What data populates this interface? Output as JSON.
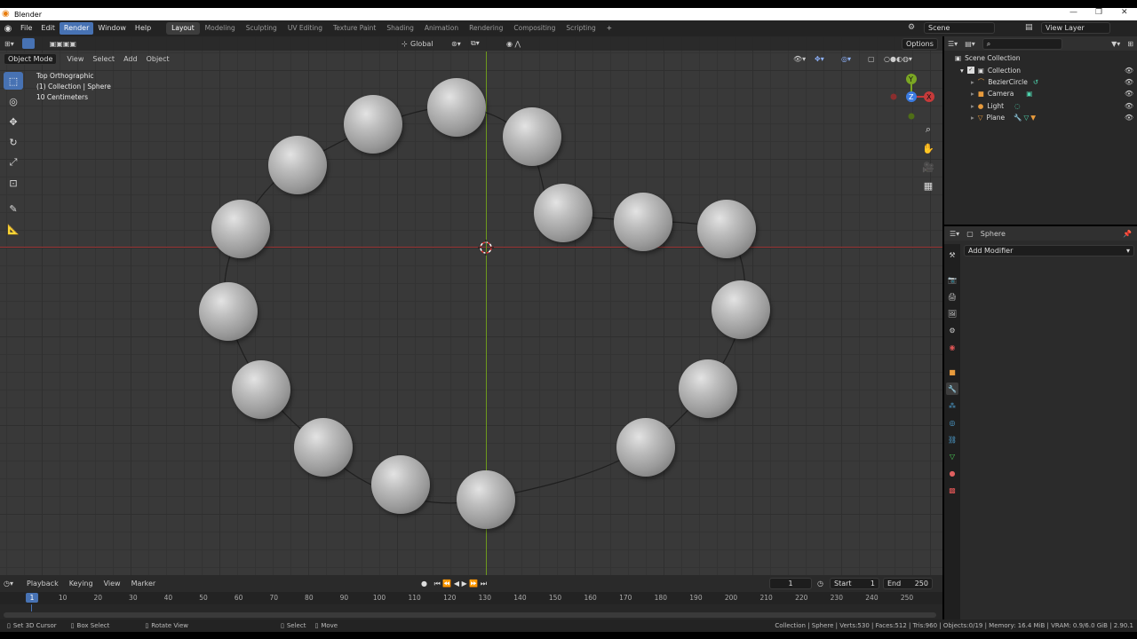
{
  "window": {
    "title": "Blender",
    "minimize": "—",
    "maximize": "❐",
    "close": "✕"
  },
  "menu": {
    "items": [
      "File",
      "Edit",
      "Render",
      "Window",
      "Help"
    ],
    "workspaces": [
      "Layout",
      "Modeling",
      "Sculpting",
      "UV Editing",
      "Texture Paint",
      "Shading",
      "Animation",
      "Rendering",
      "Compositing",
      "Scripting"
    ],
    "add_workspace": "+",
    "scene": "Scene",
    "view_layer": "View Layer"
  },
  "viewport": {
    "header": {
      "mode": "Object Mode",
      "menus": [
        "View",
        "Select",
        "Add",
        "Object"
      ],
      "transform_orientation": "Global",
      "options": "Options"
    },
    "overlay": {
      "view_name": "Top Orthographic",
      "collection": "(1) Collection | Sphere",
      "scale": "10 Centimeters"
    },
    "gizmo": {
      "y": "Y",
      "x": "X",
      "z": "Z"
    },
    "tools": [
      "select-box-icon",
      "cursor-icon",
      "move-icon",
      "rotate-icon",
      "scale-icon",
      "transform-icon",
      "annotate-icon",
      "measure-icon"
    ],
    "nav": [
      "zoom-icon",
      "hand-icon",
      "camera-icon",
      "grid-icon"
    ]
  },
  "outliner": {
    "root": "Scene Collection",
    "collection": "Collection",
    "items": [
      {
        "name": "BezierCircle",
        "icon": "curve-icon",
        "color": "#e89b3d"
      },
      {
        "name": "Camera",
        "icon": "camera-icon",
        "color": "#e89b3d"
      },
      {
        "name": "Light",
        "icon": "light-icon",
        "color": "#e89b3d"
      },
      {
        "name": "Plane",
        "icon": "mesh-icon",
        "color": "#e89b3d"
      }
    ]
  },
  "properties": {
    "object_name": "Sphere",
    "add_modifier": "Add Modifier",
    "tabs": [
      "tool",
      "render",
      "output",
      "view-layer",
      "scene",
      "world",
      "object",
      "modifier",
      "particles",
      "physics",
      "constraints",
      "data",
      "material",
      "texture"
    ]
  },
  "timeline": {
    "menus": [
      "Playback",
      "Keying",
      "View",
      "Marker"
    ],
    "current_frame": "1",
    "start_label": "Start",
    "start": "1",
    "end_label": "End",
    "end": "250",
    "ticks": [
      "10",
      "20",
      "30",
      "40",
      "50",
      "60",
      "70",
      "80",
      "90",
      "100",
      "110",
      "120",
      "130",
      "140",
      "150",
      "160",
      "170",
      "180",
      "190",
      "200",
      "210",
      "220",
      "230",
      "240",
      "250"
    ],
    "playhead": "1"
  },
  "status": {
    "left": [
      {
        "icon": "mouse-left-icon",
        "label": "Set 3D Cursor"
      },
      {
        "icon": "mouse-drag-icon",
        "label": "Box Select"
      },
      {
        "icon": "mouse-middle-icon",
        "label": "Rotate View"
      },
      {
        "icon": "mouse-left-icon",
        "label": "Select"
      },
      {
        "icon": "mouse-drag-icon",
        "label": "Move"
      }
    ],
    "right": "Collection | Sphere | Verts:530 | Faces:512 | Tris:960 | Objects:0/19 | Memory: 16.4 MiB | VRAM: 0.9/6.0 GiB | 2.90.1"
  },
  "colors": {
    "accent": "#4772b3",
    "x_axis": "#c63a3a",
    "y_axis": "#7aa623",
    "bg": "#393939"
  }
}
